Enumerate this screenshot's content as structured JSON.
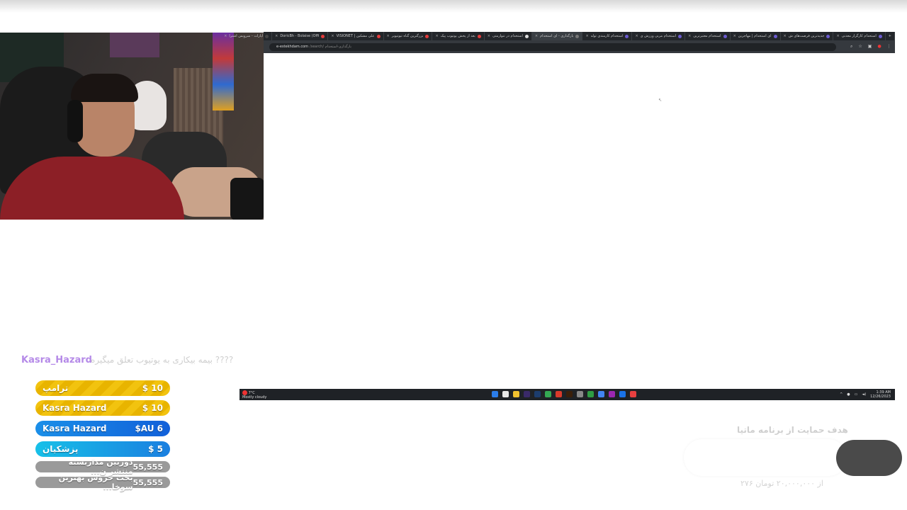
{
  "browser": {
    "tabs": [
      {
        "label": "استخدام کارگزار معدنی",
        "active": false,
        "color": "#6a5acd"
      },
      {
        "label": "جدیدترین فرصت‌های ش",
        "active": false,
        "color": "#6a5acd"
      },
      {
        "label": "ای استخدام | مهاجرین",
        "active": false,
        "color": "#6a5acd"
      },
      {
        "label": "استخدام معتبرترین",
        "active": false,
        "color": "#6a5acd"
      },
      {
        "label": "استخدام مربی ورزش ی",
        "active": false,
        "color": "#6a5acd"
      },
      {
        "label": "استخدام کارمندی توله",
        "active": false,
        "color": "#6a5acd"
      },
      {
        "label": "بارگذاری - ای استخدام",
        "active": true,
        "color": "#777777"
      },
      {
        "label": "استخدام در تنوارمتی",
        "active": false,
        "color": "#dddddd"
      },
      {
        "label": "بعد از پخش یوتیوب پیک",
        "active": false,
        "color": "#e33b3b"
      },
      {
        "label": "بزرگترین گناه تیوتیوبر",
        "active": false,
        "color": "#e33b3b"
      },
      {
        "label": "VISIONET | علی مشکین",
        "active": false,
        "color": "#e33b3b"
      },
      {
        "label": "DoricBh - Bolaise (Offi",
        "active": false,
        "color": "#e33b3b"
      },
      {
        "label": "آپارات - سرویس اشترا",
        "active": false,
        "color": "#444444"
      }
    ],
    "url": "e-estekhdam.com",
    "url_path": "/search/ بارگذاری-استخدام",
    "new_tab_label": "+"
  },
  "taskbar": {
    "weather_temp": "7°C",
    "weather_desc": "Mostly cloudy",
    "apps": [
      {
        "name": "windows-start-icon",
        "color": "#2b7de9"
      },
      {
        "name": "file-icon",
        "color": "#e8e8e8"
      },
      {
        "name": "folder-icon",
        "color": "#f2c230"
      },
      {
        "name": "premiere-icon",
        "color": "#3a2a6a"
      },
      {
        "name": "photoshop-icon",
        "color": "#1c3d6e"
      },
      {
        "name": "chrome-icon",
        "color": "#34a853"
      },
      {
        "name": "app-red-icon",
        "color": "#d93a2b"
      },
      {
        "name": "illustrator-icon",
        "color": "#3a1f0a"
      },
      {
        "name": "settings-icon",
        "color": "#888888"
      },
      {
        "name": "app-green-icon",
        "color": "#2f9e44"
      },
      {
        "name": "chrome-alt-icon",
        "color": "#4285f4"
      },
      {
        "name": "rider-icon",
        "color": "#9c27b0"
      },
      {
        "name": "app-blue-icon",
        "color": "#1a73e8"
      },
      {
        "name": "app-circle-icon",
        "color": "#e84040"
      }
    ],
    "time": "1:39 AM",
    "date": "12/26/2023"
  },
  "chat": {
    "username": "Kasra_Hazard",
    "message": "???? بیمه بیکاری به یوتیوب تعلق میگیره"
  },
  "donations": [
    {
      "name": "ترامپ",
      "amount": "$ 10",
      "style": "gold"
    },
    {
      "name": "Kasra Hazard",
      "amount": "$ 10",
      "style": "gold"
    },
    {
      "name": "Kasra Hazard",
      "amount": "$AU 6",
      "style": "blue"
    },
    {
      "name": "پزشکیان",
      "amount": "$ 5",
      "style": "cyan"
    },
    {
      "name": "دوربین مداربسته منتشر ن...",
      "amount": "55,555",
      "style": "grey"
    },
    {
      "name": "بحث خروس بهترین سوخا...",
      "amount": "55,555",
      "style": "grey"
    }
  ],
  "support": {
    "title": "هدف حمایت از برنامه ماتیا",
    "amount": "از ۲۰,۰۰۰,۰۰۰ تومان ۲۷۶"
  }
}
